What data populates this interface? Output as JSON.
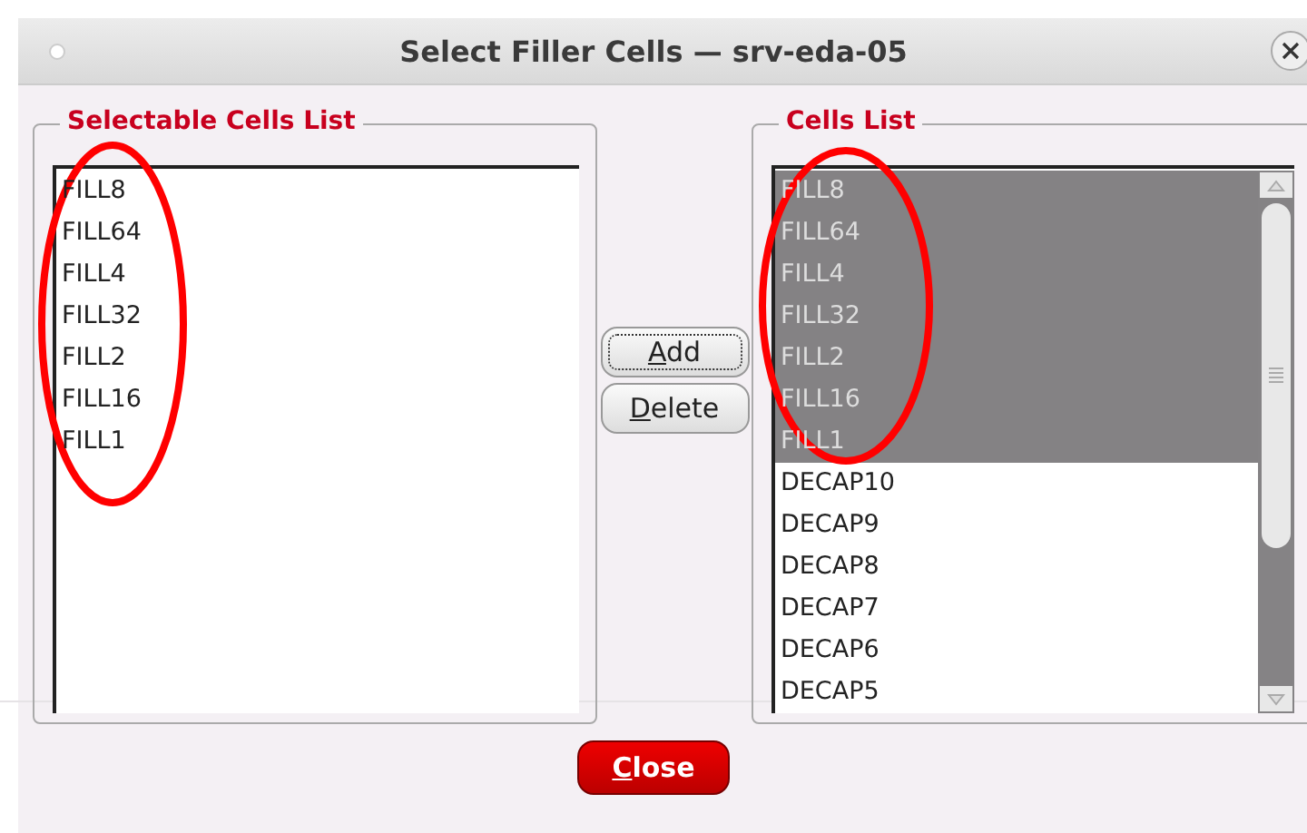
{
  "window": {
    "title": "Select Filler Cells — srv-eda-05"
  },
  "selectable_list": {
    "title": "Selectable Cells List",
    "items": [
      {
        "label": "FILL8",
        "selected": false
      },
      {
        "label": "FILL64",
        "selected": false
      },
      {
        "label": "FILL4",
        "selected": false
      },
      {
        "label": "FILL32",
        "selected": false
      },
      {
        "label": "FILL2",
        "selected": false
      },
      {
        "label": "FILL16",
        "selected": false
      },
      {
        "label": "FILL1",
        "selected": false
      }
    ]
  },
  "middle_buttons": [
    {
      "key": "A",
      "rest": "dd",
      "focused": true
    },
    {
      "key": "D",
      "rest": "elete",
      "focused": false
    }
  ],
  "cells_list": {
    "title": "Cells List",
    "items": [
      {
        "label": "FILL8",
        "selected": true
      },
      {
        "label": "FILL64",
        "selected": true
      },
      {
        "label": "FILL4",
        "selected": true
      },
      {
        "label": "FILL32",
        "selected": true
      },
      {
        "label": "FILL2",
        "selected": true
      },
      {
        "label": "FILL16",
        "selected": true
      },
      {
        "label": "FILL1",
        "selected": true
      },
      {
        "label": "DECAP10",
        "selected": false
      },
      {
        "label": "DECAP9",
        "selected": false
      },
      {
        "label": "DECAP8",
        "selected": false
      },
      {
        "label": "DECAP7",
        "selected": false
      },
      {
        "label": "DECAP6",
        "selected": false
      },
      {
        "label": "DECAP5",
        "selected": false
      }
    ]
  },
  "close_button": {
    "key": "C",
    "rest": "lose"
  },
  "annotations": [
    {
      "kind": "ellipse",
      "color": "#ff0000"
    },
    {
      "kind": "ellipse",
      "color": "#ff0000"
    }
  ]
}
